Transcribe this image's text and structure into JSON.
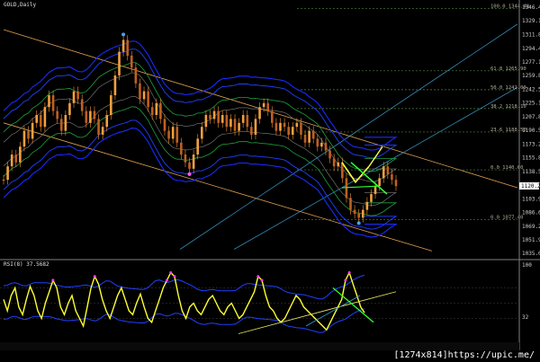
{
  "chart_data": [
    {
      "type": "candlestick",
      "title": "GOLD,Daily",
      "price_scale": {
        "labels": [
          "1346.40",
          "1329.10",
          "1311.80",
          "1294.40",
          "1277.10",
          "1259.80",
          "1242.50",
          "1225.10",
          "1207.80",
          "1190.50",
          "1173.20",
          "1155.80",
          "1138.50",
          "1121.20",
          "1103.90",
          "1086.60",
          "1069.20",
          "1051.90",
          "1035.00"
        ],
        "current_price": "1120.26"
      },
      "ylim": [
        1035,
        1346.4
      ],
      "fib_levels": [
        {
          "label": "100.0 1344.48",
          "value": 1344.5
        },
        {
          "label": "61.8 1265.90",
          "value": 1265.9
        },
        {
          "label": "50.0 1242.00",
          "value": 1242.0
        },
        {
          "label": "38.2 1218.10",
          "value": 1218.1
        },
        {
          "label": "23.6 1188.50",
          "value": 1188.5
        },
        {
          "label": "0.0 1140.60",
          "value": 1140.6
        },
        {
          "label": "0.0 1077.40",
          "value": 1077.4
        }
      ],
      "close_series": [
        1128,
        1145,
        1160,
        1150,
        1170,
        1190,
        1180,
        1200,
        1210,
        1195,
        1220,
        1235,
        1215,
        1205,
        1190,
        1210,
        1225,
        1240,
        1230,
        1215,
        1200,
        1215,
        1205,
        1185,
        1195,
        1210,
        1235,
        1260,
        1290,
        1305,
        1285,
        1270,
        1250,
        1230,
        1240,
        1220,
        1210,
        1225,
        1205,
        1190,
        1180,
        1195,
        1175,
        1160,
        1150,
        1142,
        1160,
        1180,
        1195,
        1210,
        1205,
        1215,
        1200,
        1210,
        1195,
        1205,
        1190,
        1200,
        1210,
        1195,
        1185,
        1205,
        1220,
        1225,
        1215,
        1200,
        1190,
        1200,
        1195,
        1185,
        1195,
        1200,
        1185,
        1175,
        1190,
        1180,
        1170,
        1175,
        1165,
        1155,
        1145,
        1150,
        1130,
        1105,
        1090,
        1085,
        1080,
        1090,
        1100,
        1110,
        1120,
        1130,
        1145,
        1135,
        1128,
        1120
      ]
    },
    {
      "type": "line",
      "title": "RSI(8) 37.5682",
      "axis_labels": [
        "100",
        "32"
      ],
      "ylim": [
        0,
        100
      ],
      "values": [
        55,
        40,
        60,
        70,
        45,
        35,
        55,
        72,
        60,
        40,
        30,
        50,
        65,
        80,
        70,
        45,
        35,
        50,
        60,
        40,
        30,
        20,
        45,
        70,
        85,
        75,
        55,
        40,
        30,
        45,
        60,
        70,
        55,
        40,
        35,
        50,
        62,
        45,
        30,
        25,
        40,
        55,
        70,
        80,
        90,
        85,
        60,
        40,
        30,
        45,
        50,
        40,
        35,
        45,
        55,
        60,
        50,
        40,
        35,
        45,
        50,
        40,
        30,
        35,
        45,
        55,
        65,
        85,
        80,
        60,
        45,
        40,
        30,
        25,
        30,
        40,
        50,
        60,
        55,
        45,
        40,
        35,
        30,
        25,
        20,
        15,
        25,
        35,
        45,
        55,
        80,
        90,
        75,
        60,
        45,
        37.5682
      ]
    }
  ],
  "watermark": "[1274x814]https://upic.me/"
}
